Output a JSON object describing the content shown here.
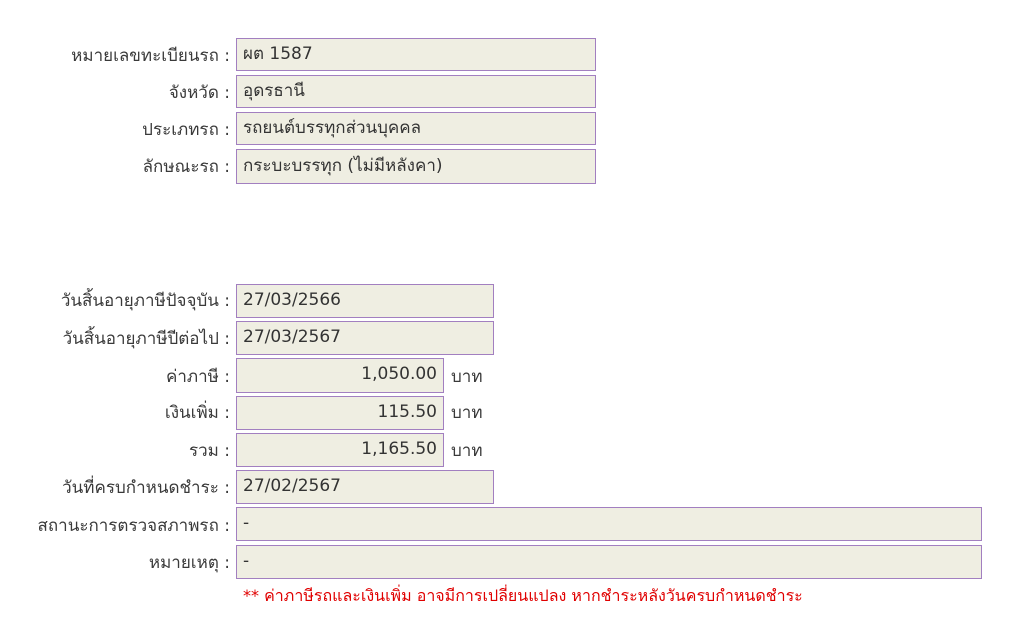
{
  "vehicle": {
    "plate_label": "หมายเลขทะเบียนรถ :",
    "plate_value": "ผต 1587",
    "province_label": "จังหวัด :",
    "province_value": "อุดรธานี",
    "type_label": "ประเภทรถ :",
    "type_value": "รถยนต์บรรทุกส่วนบุคคล",
    "style_label": "ลักษณะรถ :",
    "style_value": "กระบะบรรทุก (ไม่มีหลังคา)"
  },
  "tax": {
    "current_expiry_label": "วันสิ้นอายุภาษีปัจจุบัน :",
    "current_expiry_value": "27/03/2566",
    "next_expiry_label": "วันสิ้นอายุภาษีปีต่อไป :",
    "next_expiry_value": "27/03/2567",
    "tax_label": "ค่าภาษี :",
    "tax_value": "1,050.00",
    "surcharge_label": "เงินเพิ่ม :",
    "surcharge_value": "115.50",
    "total_label": "รวม :",
    "total_value": "1,165.50",
    "unit": "บาท",
    "due_date_label": "วันที่ครบกำหนดชำระ :",
    "due_date_value": "27/02/2567",
    "inspection_label": "สถานะการตรวจสภาพรถ :",
    "inspection_value": "-",
    "remark_label": "หมายเหตุ :",
    "remark_value": "-"
  },
  "note": "** ค่าภาษีรถและเงินเพิ่ม อาจมีการเปลี่ยนแปลง หากชำระหลังวันครบกำหนดชำระ"
}
